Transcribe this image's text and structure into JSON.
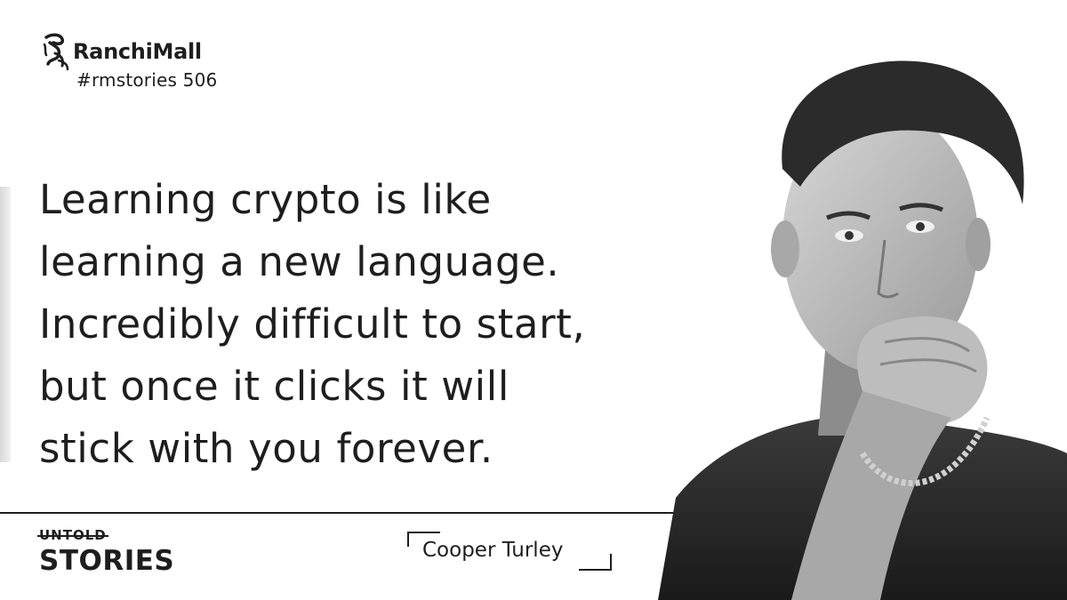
{
  "brand": {
    "logo_name": "RanchiMall",
    "hashtag": "#rmstories 506"
  },
  "quote": {
    "lines": [
      "Learning crypto is like",
      "learning a new language.",
      "Incredibly difficult to start,",
      "but once it clicks it will",
      "stick with you forever."
    ]
  },
  "series": {
    "top": "UNTOLD",
    "bottom": "STORIES"
  },
  "author": {
    "name": "Cooper Turley"
  },
  "portrait": {
    "description": "black-and-white-photo-portrait"
  }
}
